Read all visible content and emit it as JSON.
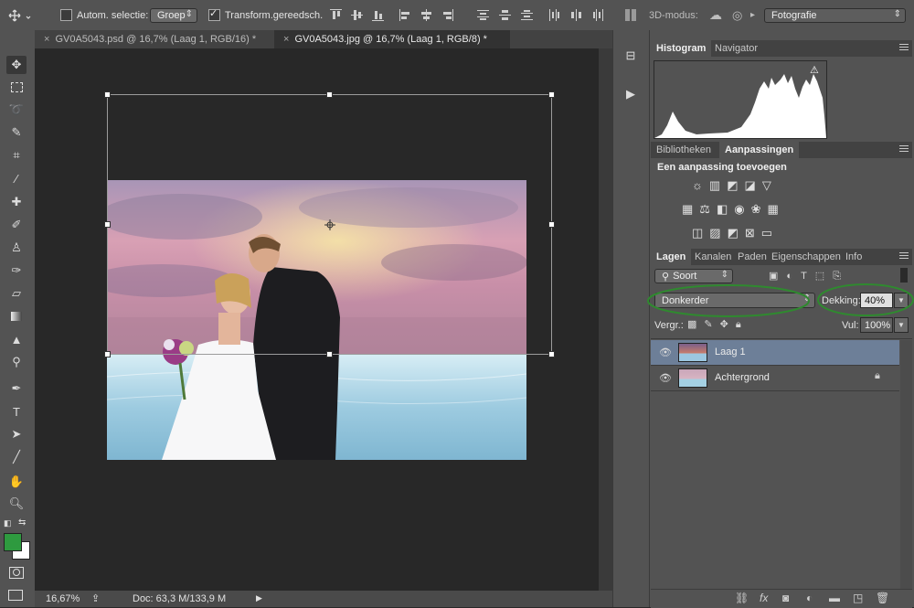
{
  "options_bar": {
    "auto_select_label": "Autom. selectie:",
    "auto_select_value": "Groep",
    "transform_label": "Transform.gereedsch.",
    "mode_3d_label": "3D-modus:",
    "workspace": "Fotografie"
  },
  "document_tabs": [
    {
      "label": "GV0A5043.psd @ 16,7% (Laag 1, RGB/16) *",
      "close": "×"
    },
    {
      "label": "GV0A5043.jpg @ 16,7% (Laag 1, RGB/8) *",
      "close": "×"
    }
  ],
  "status": {
    "zoom": "16,67%",
    "doc": "Doc: 63,3 M/133,9 M"
  },
  "histogram_panel": {
    "tabs": [
      "Histogram",
      "Navigator"
    ]
  },
  "adjustments_panel": {
    "tabs": [
      "Bibliotheken",
      "Aanpassingen"
    ],
    "heading": "Een aanpassing toevoegen"
  },
  "layers_panel": {
    "tabs": [
      "Lagen",
      "Kanalen",
      "Paden",
      "Eigenschappen",
      "Info"
    ],
    "filter_kind": "Soort",
    "blend_mode": "Donkerder",
    "opacity_label": "Dekking:",
    "opacity_value": "40%",
    "lock_label": "Vergr.:",
    "fill_label": "Vul:",
    "fill_value": "100%",
    "layers": [
      {
        "name": "Laag 1",
        "selected": true
      },
      {
        "name": "Achtergrond",
        "selected": false,
        "locked": true
      }
    ]
  },
  "colors": {
    "foreground": "#2e9a3f",
    "background": "#ffffff",
    "highlight_circle": "#2f8a2f",
    "selected_layer": "#6d7f98"
  }
}
